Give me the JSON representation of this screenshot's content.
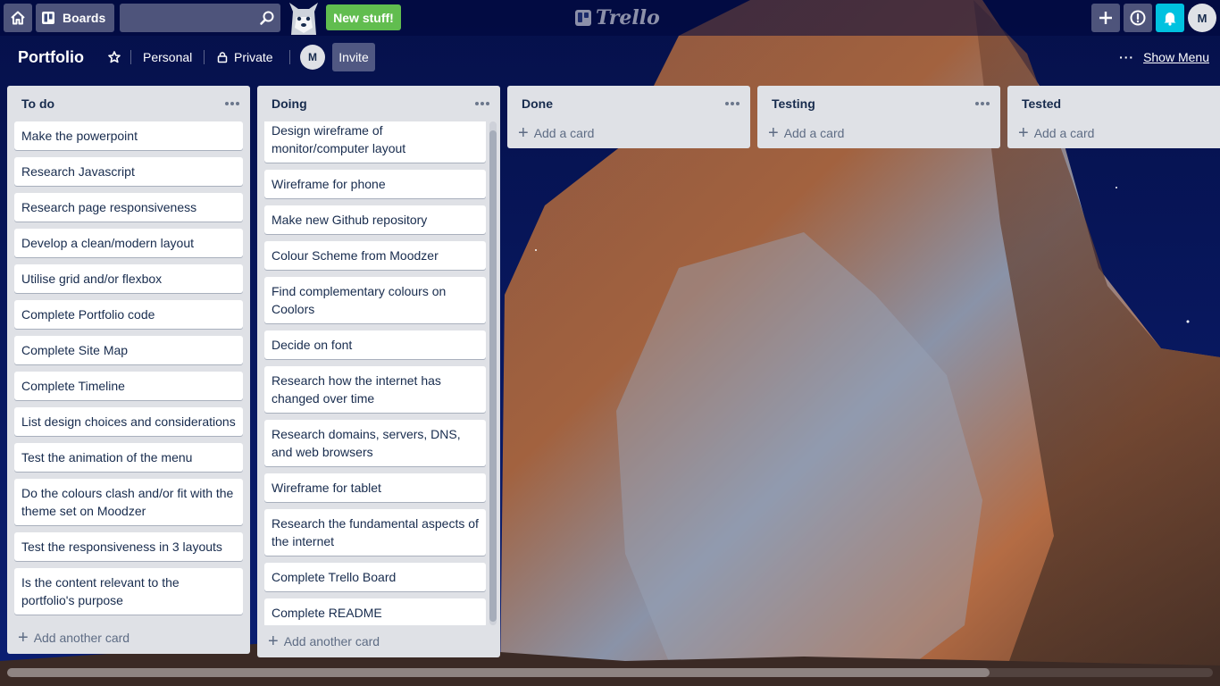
{
  "header": {
    "boards_label": "Boards",
    "search": {
      "value": "",
      "placeholder": ""
    },
    "new_stuff_label": "New stuff!",
    "logo_text": "Trello",
    "avatar_initial": "M",
    "icons": [
      "home-icon",
      "boards-icon",
      "search-icon",
      "plus-icon",
      "info-icon",
      "bell-icon"
    ],
    "colors": {
      "new_stuff": "#61bd4f",
      "notifications": "#00c2e0"
    }
  },
  "board": {
    "title": "Portfolio",
    "team_label": "Personal",
    "visibility_label": "Private",
    "member_initial": "M",
    "invite_label": "Invite",
    "show_menu_label": "Show Menu"
  },
  "lists": [
    {
      "title": "To do",
      "cards": [
        "Make the powerpoint",
        "Research Javascript",
        "Research page responsiveness",
        "Develop a clean/modern layout",
        "Utilise grid and/or flexbox",
        "Complete Portfolio code",
        "Complete Site Map",
        "Complete Timeline",
        "List design choices and considerations",
        "Test the animation of the menu",
        "Do the colours clash and/or fit with the theme set on Moodzer",
        "Test the responsiveness in 3 layouts",
        "Is the content relevant to the portfolio's purpose"
      ],
      "add_label": "Add another card"
    },
    {
      "title": "Doing",
      "cards": [
        "Design wireframe of monitor/computer layout",
        "Wireframe for phone",
        "Make new Github repository",
        "Colour Scheme from Moodzer",
        "Find complementary colours on Coolors",
        "Decide on font",
        "Research how the internet has changed over time",
        "Research domains, servers, DNS, and web browsers",
        "Wireframe for tablet",
        "Research the fundamental aspects of the internet",
        "Complete Trello Board",
        "Complete README"
      ],
      "add_label": "Add another card"
    },
    {
      "title": "Done",
      "cards": [],
      "add_label": "Add a card"
    },
    {
      "title": "Testing",
      "cards": [],
      "add_label": "Add a card"
    },
    {
      "title": "Tested",
      "cards": [],
      "add_label": "Add a card"
    }
  ]
}
